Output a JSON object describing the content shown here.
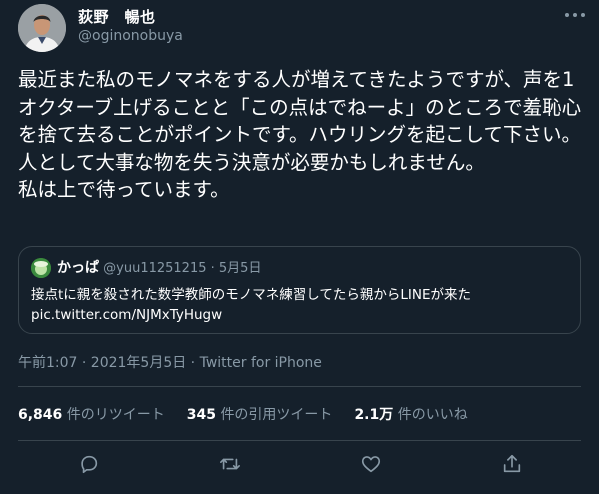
{
  "author": {
    "display_name": "荻野　暢也",
    "handle": "@oginonobuya"
  },
  "tweet": {
    "text": "最近また私のモノマネをする人が増えてきたようですが、声を1オクターブ上げることと「この点はでねーよ」のところで羞恥心を捨て去ることがポイントです。ハウリングを起こして下さい。人として大事な物を失う決意が必要かもしれません。\n私は上で待っています。"
  },
  "quoted": {
    "name": "かっぱ",
    "handle": "@yuu11251215",
    "separator": "·",
    "date": "5月5日",
    "text": "接点tに親を殺された数学教師のモノマネ練習してたら親からLINEが来た\npic.twitter.com/NJMxTyHugw"
  },
  "meta": {
    "timestamp": "午前1:07 · 2021年5月5日 · ",
    "source": "Twitter for iPhone"
  },
  "stats": {
    "retweets_num": "6,846",
    "retweets_label": "件のリツイート",
    "quotes_num": "345",
    "quotes_label": "件の引用ツイート",
    "likes_num": "2.1万",
    "likes_label": "件のいいね"
  },
  "icons": [
    "more-icon",
    "reply-icon",
    "retweet-icon",
    "like-icon",
    "share-icon"
  ],
  "colors": {
    "background": "#15202b",
    "text": "#ffffff",
    "secondary": "#8899a6",
    "border": "#38444d"
  }
}
